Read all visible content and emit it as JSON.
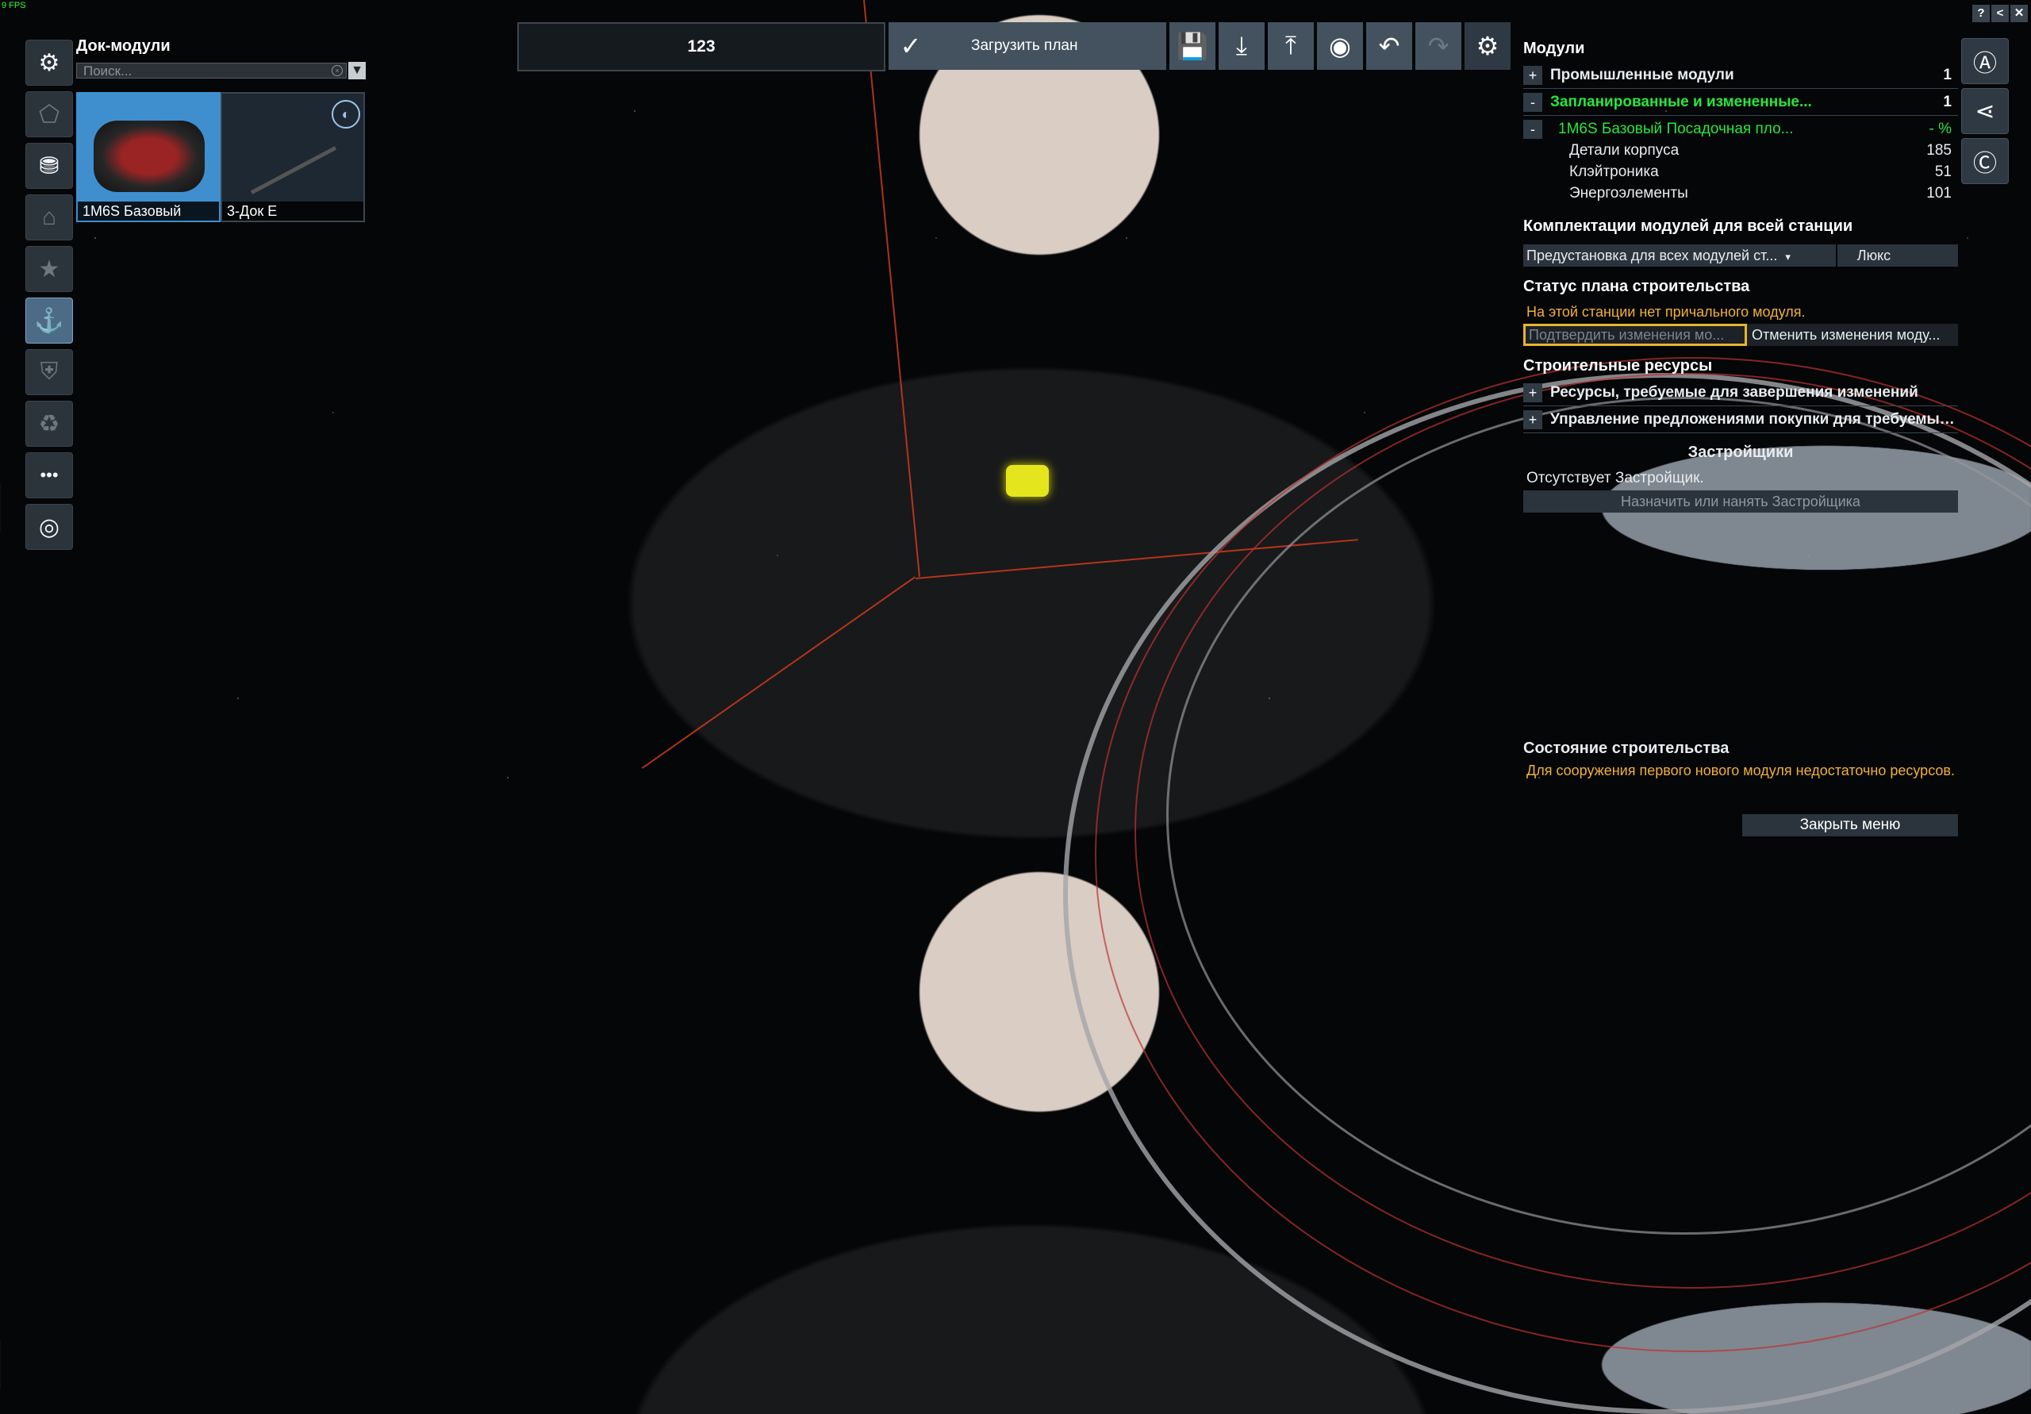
{
  "fps": "9 FPS",
  "window_controls": [
    "?",
    "<",
    "✕"
  ],
  "left_toolbar": [
    {
      "icon": "gear-cluster-icon",
      "glyph": "⚙",
      "active": false,
      "dim": false
    },
    {
      "icon": "add-module-icon",
      "glyph": "⬠",
      "active": false,
      "dim": true
    },
    {
      "icon": "storage-icon",
      "glyph": "⛃",
      "active": false,
      "dim": false
    },
    {
      "icon": "habitat-icon",
      "glyph": "⌂",
      "active": false,
      "dim": true
    },
    {
      "icon": "star-icon",
      "glyph": "★",
      "active": false,
      "dim": true
    },
    {
      "icon": "anchor-icon",
      "glyph": "⚓",
      "active": true,
      "dim": false
    },
    {
      "icon": "shield-icon",
      "glyph": "⛨",
      "active": false,
      "dim": true
    },
    {
      "icon": "recycle-icon",
      "glyph": "♻",
      "active": false,
      "dim": true
    },
    {
      "icon": "more-icon",
      "glyph": "•••",
      "active": false,
      "dim": false
    },
    {
      "icon": "spiral-icon",
      "glyph": "◎",
      "active": false,
      "dim": false
    }
  ],
  "dock_panel": {
    "title": "Док-модули",
    "search_placeholder": "Поиск...",
    "modules": [
      {
        "label": "1M6S Базовый",
        "selected": true
      },
      {
        "label": "3-Док E",
        "selected": false
      }
    ]
  },
  "topbar": {
    "plan_name": "123",
    "load_plan": "Загрузить план",
    "icons": [
      "save-icon",
      "download-icon",
      "upload-icon",
      "view-icon",
      "undo-icon",
      "redo-icon",
      "settings-icon"
    ]
  },
  "right_toolbar": [
    "build-icon",
    "share-icon",
    "credits-icon"
  ],
  "modules_panel": {
    "title": "Модули",
    "rows": [
      {
        "toggle": "+",
        "name": "Промышленные модули",
        "value": "1",
        "green": false
      },
      {
        "toggle": "-",
        "name": "Запланированные и измененные...",
        "value": "1",
        "green": true
      },
      {
        "toggle": "-",
        "name": "1M6S Базовый Посадочная пло...",
        "value": "- %",
        "green": true
      }
    ],
    "details": [
      {
        "name": "Детали корпуса",
        "value": "185"
      },
      {
        "name": "Клэйтроника",
        "value": "51"
      },
      {
        "name": "Энергоэлементы",
        "value": "101"
      }
    ],
    "loadout_title": "Комплектации модулей для всей станции",
    "loadout_dropdown": "Предустановка для всех модулей ст...",
    "loadout_value": "Люкс",
    "status_title": "Статус плана строительства",
    "status_warning": "На этой станции нет причального модуля.",
    "confirm_button": "Подтвердить изменения мо...",
    "cancel_button": "Отменить изменения моду...",
    "resources_title": "Строительные ресурсы",
    "resource_rows": [
      {
        "toggle": "+",
        "name": "Ресурсы, требуемые для завершения изменений"
      },
      {
        "toggle": "+",
        "name": "Управление предложениями покупки для требуемых ..."
      }
    ],
    "builders_title": "Застройщики",
    "builders_none": "Отсутствует Застройщик.",
    "assign_builder": "Назначить или нанять Застройщика"
  },
  "build_state": {
    "title": "Состояние строительства",
    "message": "Для сооружения первого нового модуля недостаточно ресурсов.",
    "close_menu": "Закрыть меню"
  }
}
